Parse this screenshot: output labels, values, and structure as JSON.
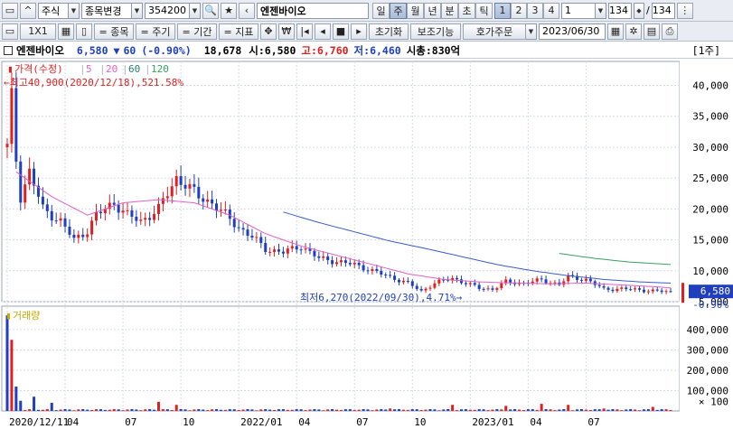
{
  "toolbar1": {
    "market": "주식",
    "change_label": "종목변경",
    "code": "354200",
    "name": "엔젠바이오",
    "periods": [
      "일",
      "주",
      "월",
      "년",
      "분",
      "초",
      "틱"
    ],
    "selected_period": "주",
    "nums": [
      "1",
      "2",
      "3",
      "4"
    ],
    "selected_num": "1",
    "n_input": "1",
    "count": "134",
    "slash": "/",
    "total": "134"
  },
  "toolbar2": {
    "layout": "1X1",
    "buttons": [
      "= 종목",
      "= 주기",
      "= 기간",
      "= 지표"
    ],
    "reset": "초기화",
    "aux": "보조기능",
    "quote": "호가주문",
    "date": "2023/06/30"
  },
  "info": {
    "name": "엔젠바이오",
    "price": "6,580",
    "arrow": "▼",
    "change": "60",
    "pct": "(-0.90%)",
    "volume": "18,678",
    "open_label": "시:",
    "open": "6,580",
    "high_label": "고:",
    "high": "6,760",
    "low_label": "저:",
    "low": "6,460",
    "cap_label": "시총:",
    "cap": "830억",
    "zoom": "[1주]"
  },
  "price_legend": {
    "name": "가격(수정)",
    "ma": [
      "5",
      "20",
      "60",
      "120"
    ],
    "ma_colors": [
      "#e060c8",
      "#e060c8",
      "#2a7a6a",
      "#3aa060"
    ]
  },
  "price_axis": [
    "40,000",
    "35,000",
    "30,000",
    "25,000",
    "20,000",
    "15,000",
    "10,000",
    "5,000"
  ],
  "vol_axis": [
    "400,000",
    "300,000",
    "200,000",
    "100,000"
  ],
  "vol_unit": "× 100",
  "current": {
    "price": "6,580",
    "pct": "-0.90%"
  },
  "annotations": {
    "high": "최고40,900(2020/12/18),521.58%",
    "low": "최저6,270(2022/09/30),4.71%"
  },
  "vol_label": "거래량",
  "x_labels": [
    "2020/12/11",
    "04",
    "07",
    "10",
    "2022/01",
    "04",
    "07",
    "10",
    "2023/01",
    "04",
    "07"
  ],
  "colors": {
    "up": "#e02020",
    "down": "#1f3fbf",
    "grid": "#d6dce6",
    "ma20": "#e060c8",
    "ma120": "#3aa060",
    "ma60": "#3a5cc8"
  },
  "chart_data": {
    "type": "candlestick",
    "interval": "weekly",
    "x_start": "2020/12/11",
    "x_end": "2023/06/30",
    "close_path": [
      [
        0,
        30000
      ],
      [
        1,
        38000
      ],
      [
        2,
        28000
      ],
      [
        3,
        22000
      ],
      [
        5,
        26000
      ],
      [
        8,
        20000
      ],
      [
        12,
        18000
      ],
      [
        15,
        15000
      ],
      [
        18,
        16500
      ],
      [
        20,
        19000
      ],
      [
        24,
        21000
      ],
      [
        27,
        19000
      ],
      [
        30,
        18000
      ],
      [
        34,
        20000
      ],
      [
        38,
        25000
      ],
      [
        40,
        24000
      ],
      [
        43,
        22000
      ],
      [
        46,
        21000
      ],
      [
        49,
        19000
      ],
      [
        52,
        17000
      ],
      [
        55,
        15500
      ],
      [
        58,
        13500
      ],
      [
        62,
        13000
      ],
      [
        66,
        14000
      ],
      [
        70,
        12000
      ],
      [
        74,
        11500
      ],
      [
        78,
        11000
      ],
      [
        82,
        10000
      ],
      [
        86,
        9000
      ],
      [
        90,
        8000
      ],
      [
        93,
        6700
      ],
      [
        96,
        8000
      ],
      [
        100,
        8800
      ],
      [
        103,
        8000
      ],
      [
        106,
        7200
      ],
      [
        109,
        7000
      ],
      [
        112,
        8200
      ],
      [
        116,
        8000
      ],
      [
        120,
        8500
      ],
      [
        124,
        7800
      ],
      [
        126,
        9000
      ],
      [
        130,
        8600
      ],
      [
        134,
        7000
      ],
      [
        138,
        7100
      ],
      [
        142,
        6900
      ],
      [
        146,
        6700
      ],
      [
        149,
        6580
      ]
    ],
    "ma20_path": [
      [
        2,
        26000
      ],
      [
        10,
        22000
      ],
      [
        18,
        19000
      ],
      [
        26,
        21000
      ],
      [
        34,
        21500
      ],
      [
        42,
        21000
      ],
      [
        50,
        19000
      ],
      [
        58,
        16000
      ],
      [
        66,
        14000
      ],
      [
        74,
        12500
      ],
      [
        82,
        11000
      ],
      [
        90,
        9500
      ],
      [
        98,
        8600
      ],
      [
        106,
        8200
      ],
      [
        114,
        8000
      ],
      [
        122,
        7900
      ],
      [
        130,
        8000
      ],
      [
        138,
        7700
      ],
      [
        146,
        7400
      ],
      [
        149,
        7200
      ]
    ],
    "ma60_path": [
      [
        62,
        19500
      ],
      [
        70,
        17800
      ],
      [
        78,
        16300
      ],
      [
        86,
        14800
      ],
      [
        94,
        13600
      ],
      [
        102,
        12300
      ],
      [
        110,
        11000
      ],
      [
        118,
        10000
      ],
      [
        126,
        9200
      ],
      [
        134,
        8600
      ],
      [
        142,
        8200
      ],
      [
        149,
        8000
      ]
    ],
    "ma120_path": [
      [
        124,
        12800
      ],
      [
        132,
        12000
      ],
      [
        140,
        11400
      ],
      [
        149,
        11000
      ]
    ],
    "volume_peaks": [
      [
        0,
        470000
      ],
      [
        1,
        350000
      ],
      [
        2,
        120000
      ],
      [
        3,
        50000
      ],
      [
        6,
        70000
      ],
      [
        10,
        40000
      ],
      [
        34,
        45000
      ],
      [
        38,
        30000
      ],
      [
        86,
        12000
      ],
      [
        100,
        30000
      ],
      [
        112,
        25000
      ],
      [
        120,
        35000
      ],
      [
        126,
        30000
      ],
      [
        134,
        12000
      ],
      [
        145,
        20000
      ]
    ],
    "price_range": [
      5000,
      43000
    ],
    "volume_range": [
      0,
      480000
    ]
  }
}
